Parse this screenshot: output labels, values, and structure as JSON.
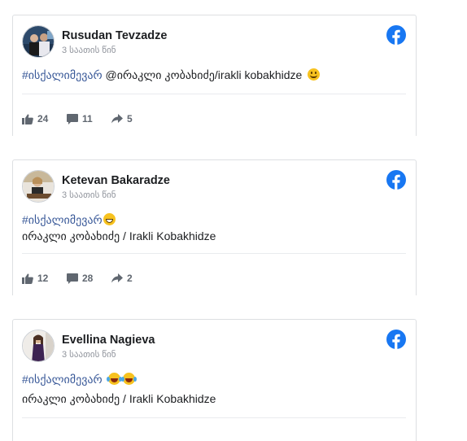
{
  "colors": {
    "hashtag": "#385898",
    "facebook_blue": "#1877f2",
    "meta": "#90949c",
    "action": "#606770"
  },
  "posts": [
    {
      "author": "Rusudan Tevzadze",
      "time": "3 საათის წინ",
      "hashtag": "#ისქალიმევარ",
      "line1_rest": " @ირაკლი კობახიძე/irakli kobakhidze",
      "line2": "",
      "emojis": [
        "slightly-smiling-face"
      ],
      "likes": "24",
      "comments": "11",
      "shares": "5"
    },
    {
      "author": "Ketevan Bakaradze",
      "time": "3 საათის წინ",
      "hashtag": "#ისქალიმევარ",
      "line1_rest": "",
      "line2": "ირაკლი კობახიძე / Irakli Kobakhidze",
      "emojis": [
        "grinning-face"
      ],
      "likes": "12",
      "comments": "28",
      "shares": "2"
    },
    {
      "author": "Evellina Nagieva",
      "time": "3 საათის წინ",
      "hashtag": "#ისქალიმევარ",
      "line1_rest": "",
      "line2": "ირაკლი კობახიძე / Irakli Kobakhidze",
      "emojis": [
        "face-with-tears-of-joy",
        "face-with-tears-of-joy"
      ]
    }
  ]
}
